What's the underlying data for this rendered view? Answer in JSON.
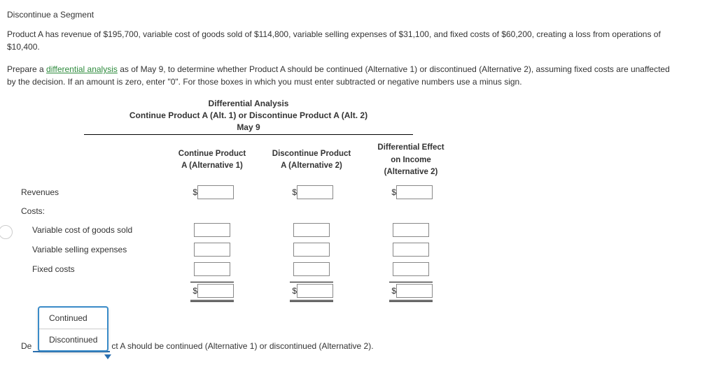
{
  "title": "Discontinue a Segment",
  "para1_a": "Product A has revenue of ",
  "para1_rev": "$195,700",
  "para1_b": ", variable cost of goods sold of ",
  "para1_vcogs": "$114,800",
  "para1_c": ", variable selling expenses of ",
  "para1_vsell": "$31,100",
  "para1_d": ", and fixed costs of ",
  "para1_fixed": "$60,200",
  "para1_e": ", creating a loss from operations of ",
  "para1_loss": "$10,400",
  "para1_f": ".",
  "para2_a": "Prepare a ",
  "para2_link": "differential analysis",
  "para2_b": " as of May 9, to determine whether Product A should be continued (Alternative 1) or discontinued (Alternative 2), assuming fixed costs are unaffected by the decision. If an amount is zero, enter \"0\". For those boxes in which you must enter subtracted or negative numbers use a minus sign.",
  "analysis": {
    "h1": "Differential Analysis",
    "h2": "Continue Product A (Alt. 1) or Discontinue Product A (Alt. 2)",
    "h3": "May 9",
    "col1a": "Continue Product",
    "col1b": "A (Alternative 1)",
    "col2a": "Discontinue Product",
    "col2b": "A (Alternative 2)",
    "col3a": "Differential Effect",
    "col3b": "on Income",
    "col3c": "(Alternative 2)",
    "row_rev": "Revenues",
    "row_costs": "Costs:",
    "row_vcogs": "Variable cost of goods sold",
    "row_vsell": "Variable selling expenses",
    "row_fixed": "Fixed costs",
    "dollar": "$"
  },
  "dropdown": {
    "opt1": "Continued",
    "opt2": "Discontinued"
  },
  "decision_a": "De",
  "decision_b": "ct A should be continued (Alternative 1) or discontinued (Alternative 2)."
}
